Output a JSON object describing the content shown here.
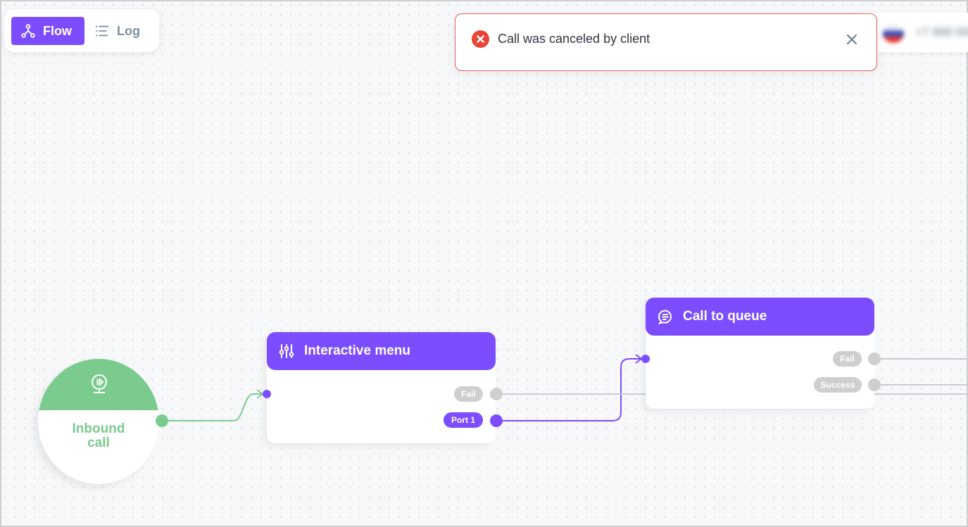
{
  "view_switch": {
    "tabs": [
      {
        "label": "Flow",
        "icon": "flow-diagram-icon",
        "active": true
      },
      {
        "label": "Log",
        "icon": "list-icon",
        "active": false
      }
    ]
  },
  "toast": {
    "message": "Call was canceled by client",
    "icon": "error-circle-icon",
    "close_icon": "close-icon"
  },
  "phone": {
    "number": "+7 999 000 00 00",
    "flag_icon": "country-flag-icon"
  },
  "nodes": {
    "inbound": {
      "line1": "Inbound",
      "line2": "call",
      "icon": "phone-play-icon"
    },
    "interactive_menu": {
      "title": "Interactive menu",
      "icon": "sliders-icon",
      "ports": [
        "Fail",
        "Port 1"
      ]
    },
    "call_to_queue": {
      "title": "Call to queue",
      "icon": "queue-chat-icon",
      "ports": [
        "Fail",
        "Success"
      ]
    }
  },
  "colors": {
    "accent": "#7c4dff",
    "inbound_green": "#7ccb8e",
    "error": "#ea4335",
    "port_grey": "#cfcfcf",
    "wire_grey": "#c9cbcf"
  }
}
